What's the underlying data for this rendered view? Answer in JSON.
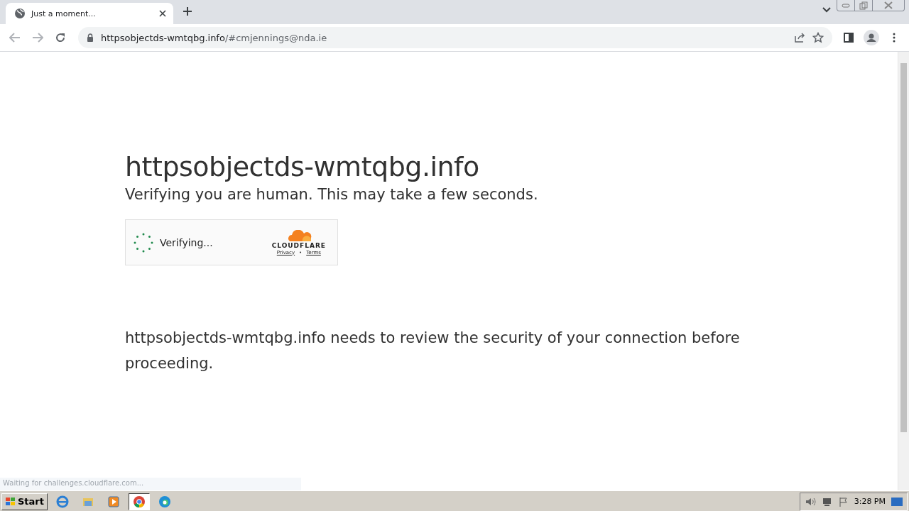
{
  "tab": {
    "title": "Just a moment...",
    "selected": true
  },
  "address_bar": {
    "url_host": "httpsobjectds-wmtqbg.info",
    "url_rest": "/#cmjennings@nda.ie"
  },
  "page": {
    "heading": "httpsobjectds-wmtqbg.info",
    "subtitle": "Verifying you are human. This may take a few seconds.",
    "widget": {
      "status": "Verifying...",
      "brand": "CLOUDFLARE",
      "links": [
        "Privacy",
        "Terms"
      ],
      "separator": "•"
    },
    "message": "httpsobjectds-wmtqbg.info needs to review the security of your connection before proceeding."
  },
  "status_bubble": "Waiting for challenges.cloudflare.com...",
  "taskbar": {
    "start": "Start",
    "apps": [
      {
        "kind": "ie",
        "selected": false
      },
      {
        "kind": "folder",
        "selected": false
      },
      {
        "kind": "media",
        "selected": false
      },
      {
        "kind": "chrome",
        "selected": true
      },
      {
        "kind": "edge",
        "selected": false
      }
    ],
    "clock": "3:28 PM"
  }
}
